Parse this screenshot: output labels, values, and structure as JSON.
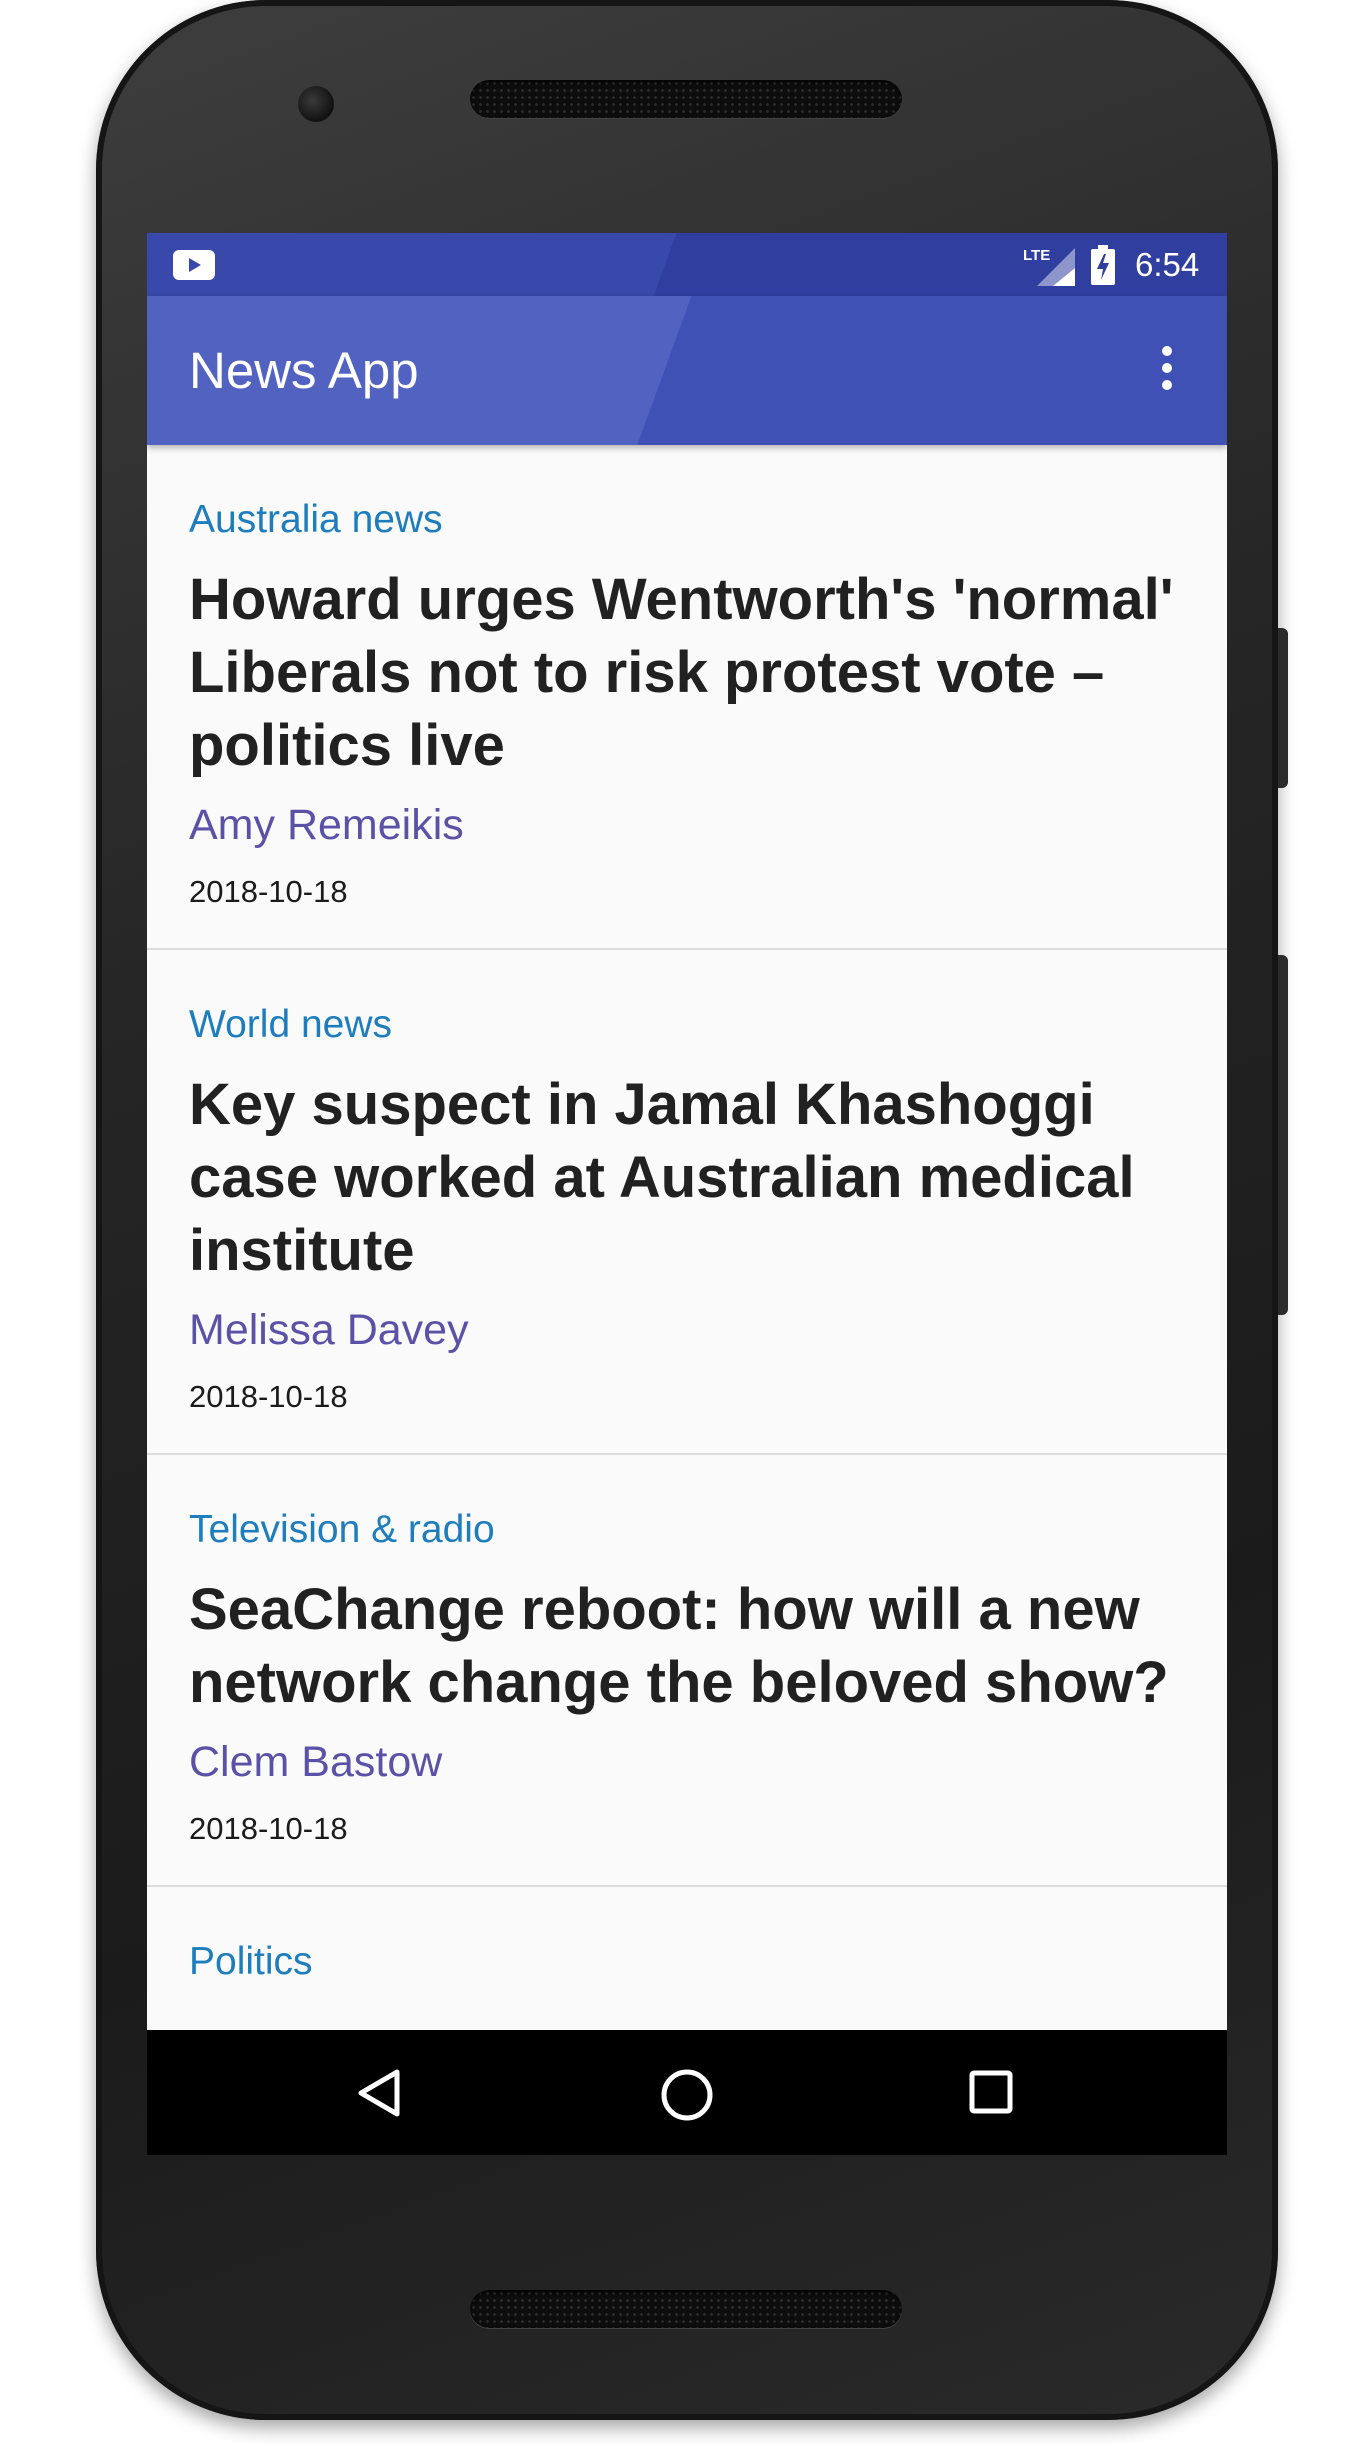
{
  "status_bar": {
    "time": "6:54",
    "network_label": "LTE",
    "icons": [
      "youtube-icon",
      "lte-signal-icon",
      "battery-charging-icon"
    ]
  },
  "app_bar": {
    "title": "News App",
    "overflow_icon": "more-vert-icon"
  },
  "articles": [
    {
      "section": "Australia news",
      "headline": "Howard urges Wentworth's 'normal' Liberals not to risk protest vote  – politics live",
      "author": "Amy Remeikis",
      "date": "2018-10-18"
    },
    {
      "section": "World news",
      "headline": "Key suspect in Jamal Khashoggi case worked at Australian medical institute",
      "author": "Melissa Davey",
      "date": "2018-10-18"
    },
    {
      "section": "Television & radio",
      "headline": "SeaChange reboot: how will a new network change the beloved show?",
      "author": "Clem Bastow",
      "date": "2018-10-18"
    }
  ],
  "partial_next_section": "Politics",
  "nav_bar": {
    "icons": [
      "back-icon",
      "home-icon",
      "recent-apps-icon"
    ]
  },
  "colors": {
    "status_bar": "#303f9f",
    "app_bar": "#3f51b5",
    "section_text": "#1e7dbd",
    "author_text": "#5b52a8",
    "headline_text": "#212121"
  }
}
